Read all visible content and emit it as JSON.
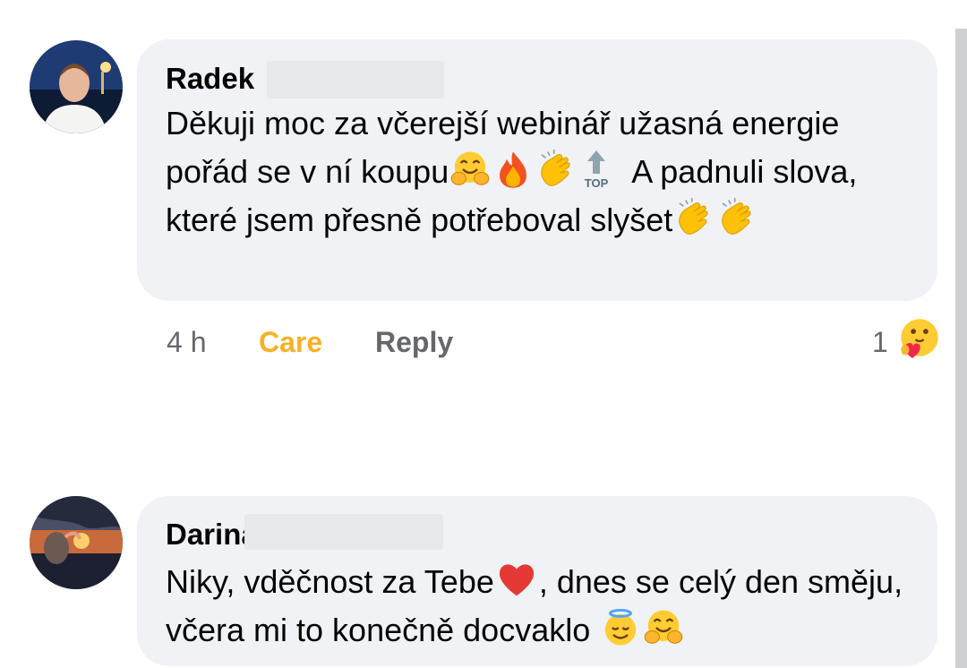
{
  "comments": [
    {
      "author": "Radek",
      "text_parts": [
        "Děkuji moc za včerejší webinář užasná energie pořád se v ní koupu",
        "A padnuli slova, které jsem přesně potřeboval slyšet"
      ],
      "icons": [
        "hugging-face-icon",
        "fire-icon",
        "clapping-hands-icon",
        "top-arrow-icon",
        "clapping-hands-icon",
        "clapping-hands-icon"
      ],
      "top_label": "TOP",
      "time": "4 h",
      "reaction_label": "Care",
      "reply_label": "Reply",
      "reaction_count": "1",
      "reaction_icon": "care-reaction-icon"
    },
    {
      "author": "Darina",
      "text_parts": [
        "Niky, vděčnost za Tebe",
        ", dnes se celý den směju, včera mi to konečně docvaklo"
      ],
      "icons": [
        "red-heart-icon",
        "smiling-face-with-halo-icon",
        "hugging-face-icon"
      ]
    }
  ],
  "colors": {
    "bubble": "#f0f2f5",
    "care": "#f7b125",
    "muted": "#65676b",
    "scrollbar": "#cfd0d2"
  }
}
